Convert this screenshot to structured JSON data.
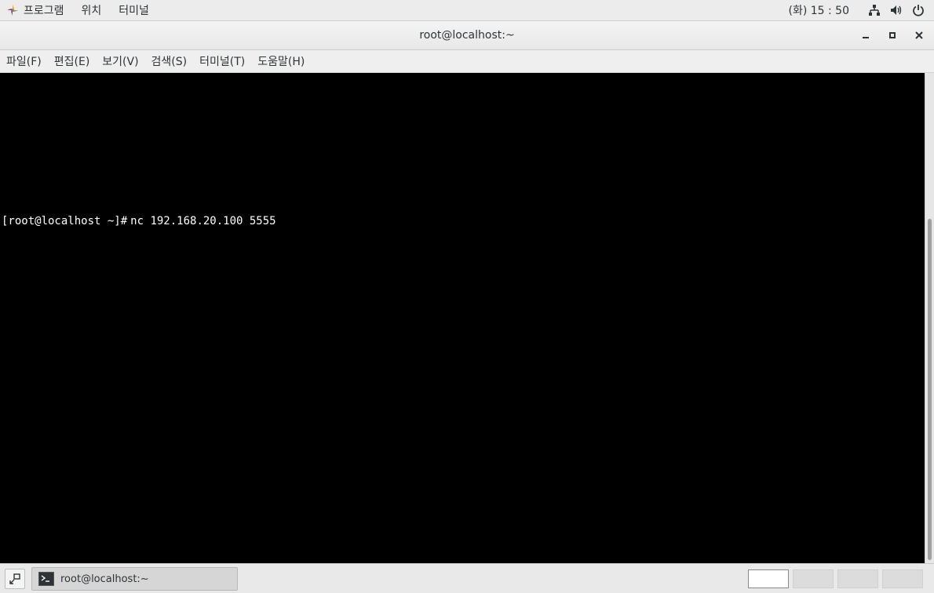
{
  "top_panel": {
    "apps_menu": "프로그램",
    "places_menu": "위치",
    "terminal_menu": "터미널",
    "clock": "(화) 15 : 50"
  },
  "window": {
    "title": "root@localhost:~"
  },
  "menubar": {
    "items": [
      "파일(F)",
      "편집(E)",
      "보기(V)",
      "검색(S)",
      "터미널(T)",
      "도움말(H)"
    ]
  },
  "terminal": {
    "prompt": "[root@localhost ~]#",
    "command": "nc 192.168.20.100 5555"
  },
  "taskbar": {
    "task_label": "root@localhost:~"
  },
  "icons": {
    "apps": "apps-logo-icon",
    "network": "network-icon",
    "volume": "volume-icon",
    "power": "power-icon",
    "minimize": "minimize-icon",
    "maximize": "maximize-icon",
    "close": "close-icon",
    "show_desktop": "show-desktop-icon",
    "terminal_app": "terminal-icon"
  }
}
